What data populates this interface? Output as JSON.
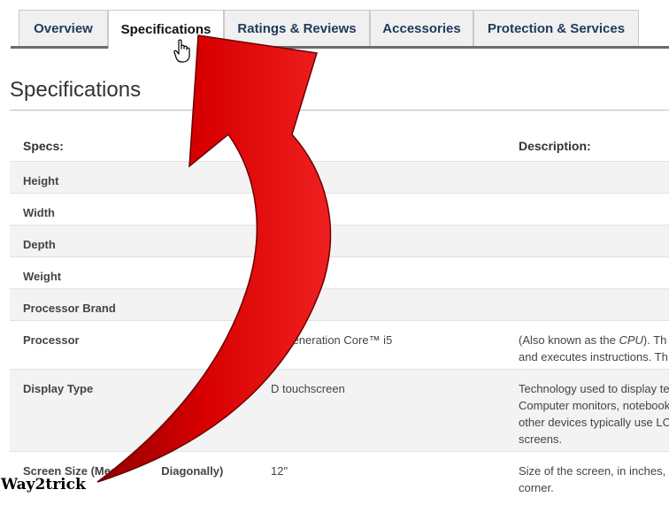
{
  "tabs": [
    {
      "label": "Overview",
      "active": false
    },
    {
      "label": "Specifications",
      "active": true
    },
    {
      "label": "Ratings & Reviews",
      "active": false
    },
    {
      "label": "Accessories",
      "active": false
    },
    {
      "label": "Protection & Services",
      "active": false
    }
  ],
  "page_title": "Specifications",
  "table": {
    "headers": {
      "spec": "Specs:",
      "value": "",
      "description": "Description:"
    },
    "rows": [
      {
        "spec": "Height",
        "value": "",
        "description": [
          ""
        ]
      },
      {
        "spec": "Width",
        "value": "",
        "description": [
          ""
        ]
      },
      {
        "spec": "Depth",
        "value": "",
        "description": [
          ""
        ]
      },
      {
        "spec": "Weight",
        "value": "",
        "description": [
          ""
        ]
      },
      {
        "spec": "Processor Brand",
        "value": "",
        "description": [
          ""
        ]
      },
      {
        "spec": "Processor",
        "value": "th Generation Core™ i5",
        "description": [
          "(Also known as the CPU). Th",
          "and executes instructions. Th"
        ]
      },
      {
        "spec": "Display Type",
        "value": "D touchscreen",
        "description": [
          "Technology used to display te",
          "Computer monitors, notebook",
          "other devices typically use LC",
          "screens."
        ]
      },
      {
        "spec": "Screen Size (Mea",
        "value": "12\"",
        "description": [
          "Size of the screen, in inches,",
          "corner."
        ]
      }
    ]
  },
  "screen_size_suffix": "Diagonally)",
  "watermark": "Way2trick",
  "colors": {
    "arrow": "#d40000",
    "tab_text": "#1f3a5a",
    "row_shade": "#f3f3f3"
  },
  "icons": {
    "cursor": "hand-pointer-icon",
    "arrow": "curved-arrow-annotation"
  }
}
